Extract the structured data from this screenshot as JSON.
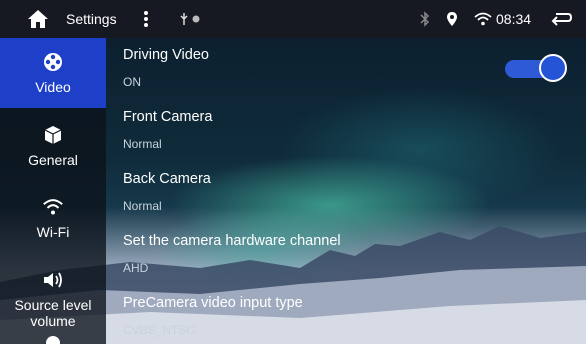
{
  "status_bar": {
    "title": "Settings",
    "time": "08:34",
    "icons": [
      "home-icon",
      "more-vert-icon",
      "usb-icon",
      "dot-icon",
      "bluetooth-icon",
      "location-pin-icon",
      "wifi-icon",
      "back-icon"
    ]
  },
  "sidebar": {
    "items": [
      {
        "label": "Video",
        "icon": "film-reel-icon",
        "active": true
      },
      {
        "label": "General",
        "icon": "cube-icon",
        "active": false
      },
      {
        "label": "Wi-Fi",
        "icon": "wifi-icon",
        "active": false
      },
      {
        "label": "Source level volume",
        "icon": "speaker-icon",
        "active": false
      }
    ]
  },
  "settings": [
    {
      "title": "Driving Video",
      "value": "ON"
    },
    {
      "title": "Front Camera",
      "value": "Normal"
    },
    {
      "title": "Back Camera",
      "value": "Normal"
    },
    {
      "title": "Set the camera hardware channel",
      "value": "AHD"
    },
    {
      "title": "PreCamera video input type",
      "value": "CVBS_NTSC"
    }
  ],
  "toggle": {
    "state": "on"
  },
  "colors": {
    "accent": "#1e40c8",
    "toggle": "#2e5ad8",
    "statusbar": "#19191f"
  }
}
